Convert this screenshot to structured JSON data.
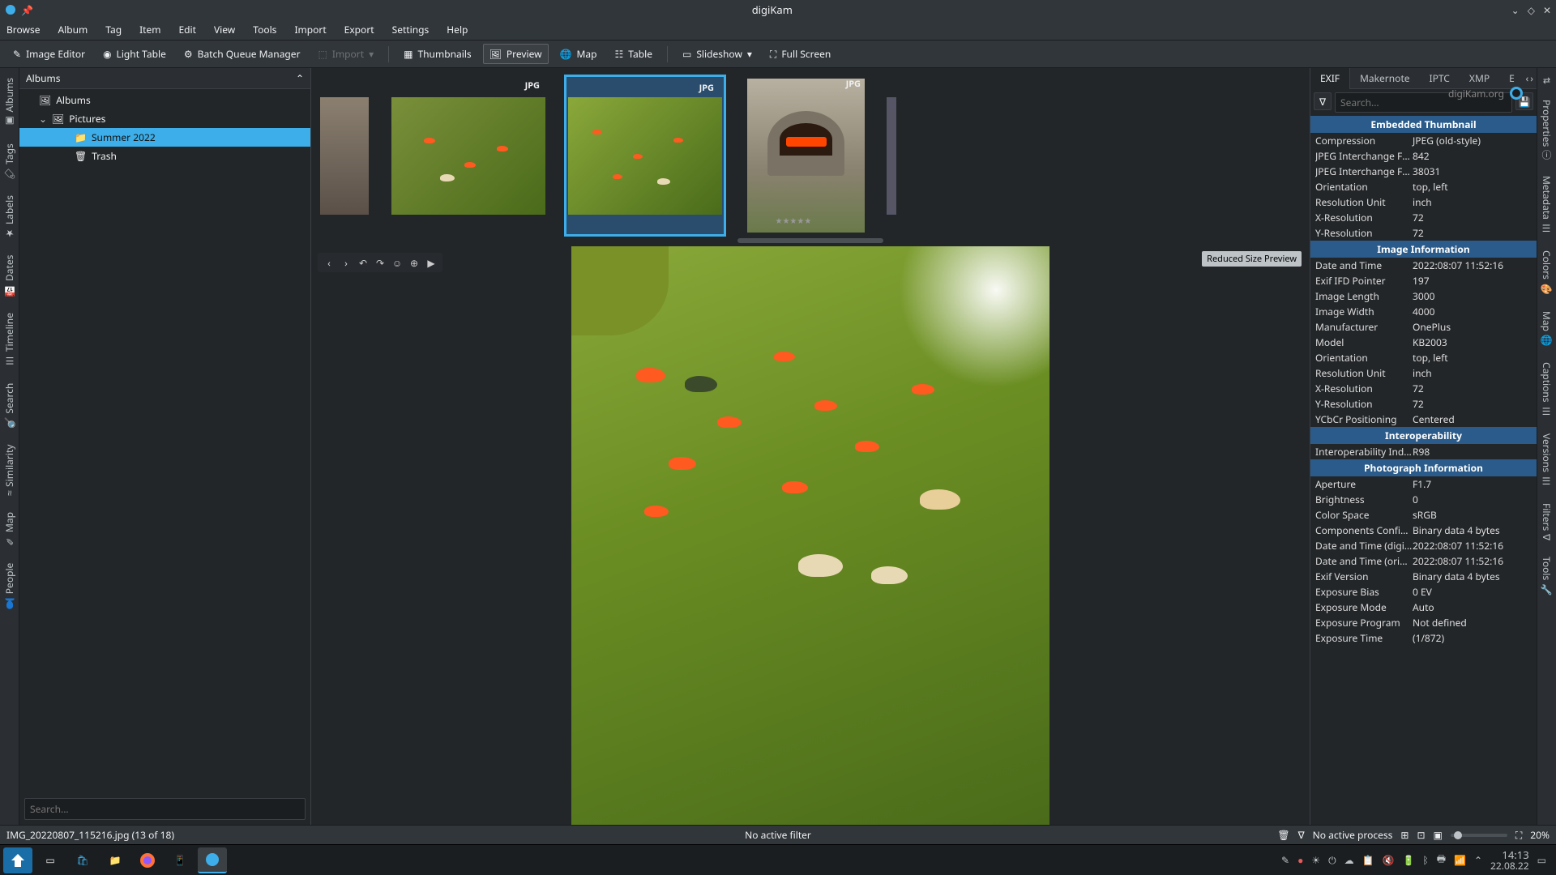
{
  "window": {
    "title": "digiKam"
  },
  "menubar": [
    "Browse",
    "Album",
    "Tag",
    "Item",
    "Edit",
    "View",
    "Tools",
    "Import",
    "Export",
    "Settings",
    "Help"
  ],
  "toolbar": {
    "image_editor": "Image Editor",
    "light_table": "Light Table",
    "batch": "Batch Queue Manager",
    "import": "Import",
    "thumbnails": "Thumbnails",
    "preview": "Preview",
    "map": "Map",
    "table": "Table",
    "slideshow": "Slideshow",
    "fullscreen": "Full Screen"
  },
  "brand": "digiKam.org",
  "left_tabs": [
    "Albums",
    "Tags",
    "Labels",
    "Dates",
    "Timeline",
    "Search",
    "Similarity",
    "Map",
    "People"
  ],
  "right_tabs": [
    "Properties",
    "Metadata",
    "Colors",
    "Map",
    "Captions",
    "Versions",
    "Filters",
    "Tools"
  ],
  "albums_panel": {
    "title": "Albums",
    "root": "Albums",
    "pictures": "Pictures",
    "summer": "Summer 2022",
    "trash": "Trash",
    "search_ph": "Search..."
  },
  "thumbs": {
    "badge": "JPG"
  },
  "preview": {
    "badge": "Reduced Size Preview"
  },
  "meta_tabs": {
    "exif": "EXIF",
    "makernote": "Makernote",
    "iptc": "IPTC",
    "xmp": "XMP",
    "extra": "E"
  },
  "meta_search_ph": "Search...",
  "meta": {
    "s1": "Embedded Thumbnail",
    "s1rows": [
      [
        "Compression",
        "JPEG (old-style)"
      ],
      [
        "JPEG Interchange Format",
        "842"
      ],
      [
        "JPEG Interchange Form...",
        "38031"
      ],
      [
        "Orientation",
        "top, left"
      ],
      [
        "Resolution Unit",
        "inch"
      ],
      [
        "X-Resolution",
        "72"
      ],
      [
        "Y-Resolution",
        "72"
      ]
    ],
    "s2": "Image Information",
    "s2rows": [
      [
        "Date and Time",
        "2022:08:07 11:52:16"
      ],
      [
        "Exif IFD Pointer",
        "197"
      ],
      [
        "Image Length",
        "3000"
      ],
      [
        "Image Width",
        "4000"
      ],
      [
        "Manufacturer",
        "OnePlus"
      ],
      [
        "Model",
        "KB2003"
      ],
      [
        "Orientation",
        "top, left"
      ],
      [
        "Resolution Unit",
        "inch"
      ],
      [
        "X-Resolution",
        "72"
      ],
      [
        "Y-Resolution",
        "72"
      ],
      [
        "YCbCr Positioning",
        "Centered"
      ]
    ],
    "s3": "Interoperability",
    "s3rows": [
      [
        "Interoperability Index",
        "R98"
      ]
    ],
    "s4": "Photograph Information",
    "s4rows": [
      [
        "Aperture",
        "F1.7"
      ],
      [
        "Brightness",
        "0"
      ],
      [
        "Color Space",
        "sRGB"
      ],
      [
        "Components Configura...",
        "Binary data 4 bytes"
      ],
      [
        "Date and Time (digitized)",
        "2022:08:07 11:52:16"
      ],
      [
        "Date and Time (original)",
        "2022:08:07 11:52:16"
      ],
      [
        "Exif Version",
        "Binary data 4 bytes"
      ],
      [
        "Exposure Bias",
        "0 EV"
      ],
      [
        "Exposure Mode",
        "Auto"
      ],
      [
        "Exposure Program",
        "Not defined"
      ],
      [
        "Exposure Time",
        "(1/872)"
      ]
    ]
  },
  "status": {
    "file": "IMG_20220807_115216.jpg (13 of 18)",
    "filter": "No active filter",
    "process": "No active process",
    "zoom": "20%"
  },
  "clock": {
    "time": "14:13",
    "date": "22.08.22"
  }
}
